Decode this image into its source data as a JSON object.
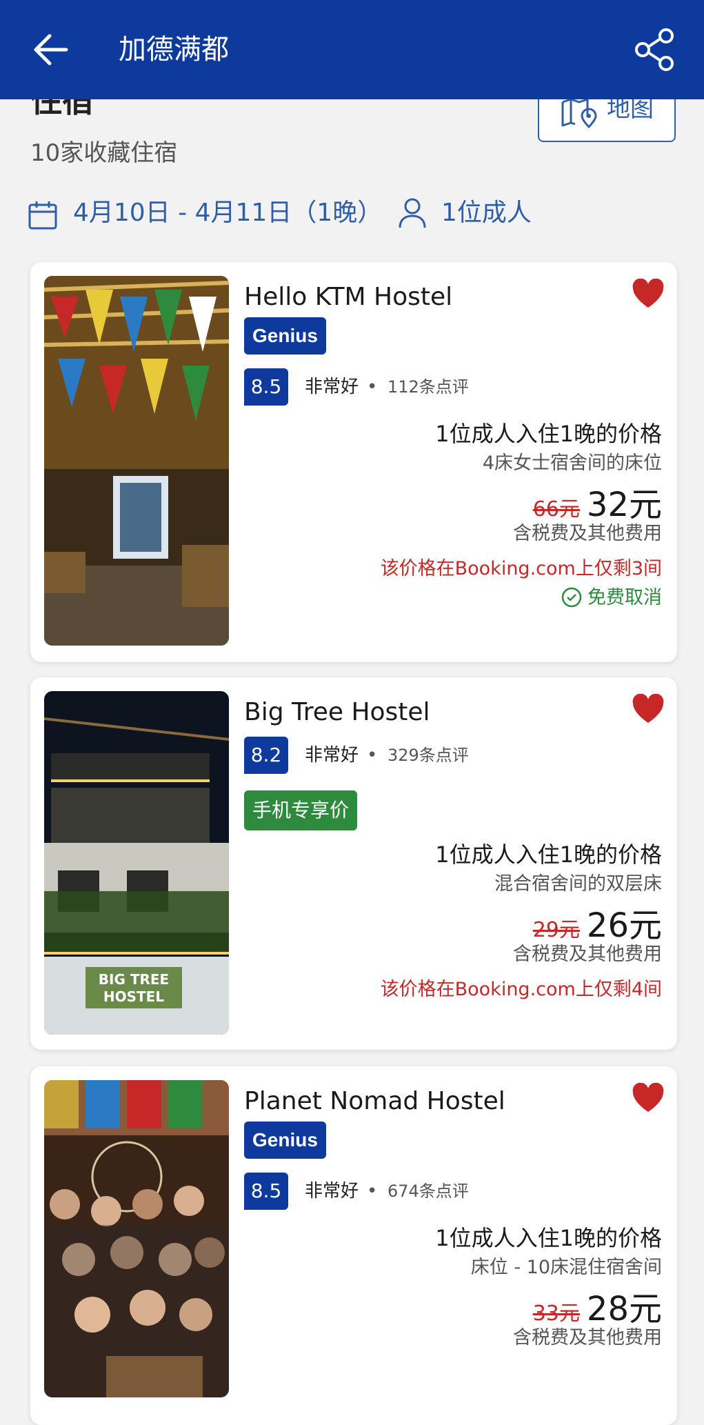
{
  "header": {
    "title": "加德满都"
  },
  "section": {
    "title": "住宿",
    "map_label": "地图",
    "saved_count": "10家收藏住宿"
  },
  "search": {
    "dates": "4月10日 - 4月11日（1晚）",
    "guests": "1位成人"
  },
  "colors": {
    "brand": "#0e3a9e",
    "accent": "#2f5ea8",
    "alert": "#c62828",
    "success": "#2e8b3e",
    "heart": "#c62828"
  },
  "hotels": [
    {
      "name": "Hello KTM Hostel",
      "genius": "Genius",
      "score": "8.5",
      "score_label": "非常好",
      "dot": "•",
      "reviews": "112条点评",
      "price_desc": "1位成人入住1晚的价格",
      "room_type": "4床女士宿舍间的床位",
      "old_price": "66元",
      "new_price": "32元",
      "tax_note": "含税费及其他费用",
      "scarcity": "该价格在Booking.com上仅剩3间",
      "free_cancel": "免费取消",
      "saved": true
    },
    {
      "name": "Big Tree Hostel",
      "score": "8.2",
      "score_label": "非常好",
      "dot": "•",
      "reviews": "329条点评",
      "mobile_badge": "手机专享价",
      "price_desc": "1位成人入住1晚的价格",
      "room_type": "混合宿舍间的双层床",
      "old_price": "29元",
      "new_price": "26元",
      "tax_note": "含税费及其他费用",
      "scarcity": "该价格在Booking.com上仅剩4间",
      "saved": true
    },
    {
      "name": "Planet Nomad Hostel",
      "genius": "Genius",
      "score": "8.5",
      "score_label": "非常好",
      "dot": "•",
      "reviews": "674条点评",
      "price_desc": "1位成人入住1晚的价格",
      "room_type": "床位 - 10床混住宿舍间",
      "old_price": "33元",
      "new_price": "28元",
      "tax_note": "含税费及其他费用",
      "saved": true
    }
  ]
}
